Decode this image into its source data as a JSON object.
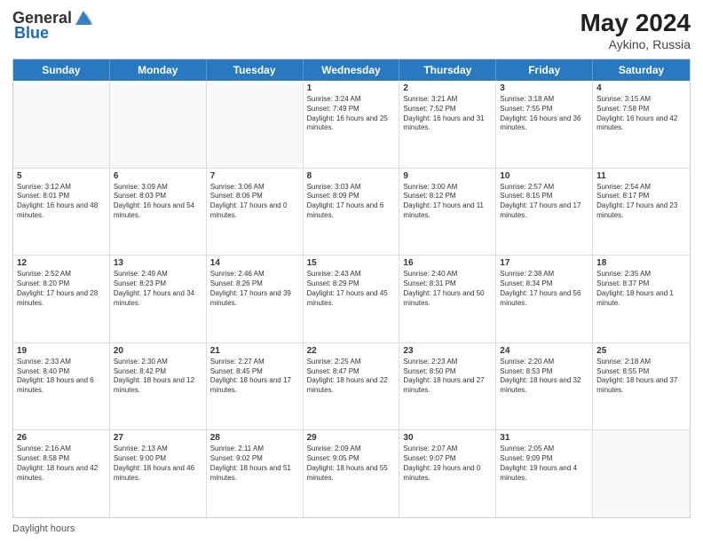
{
  "header": {
    "logo_general": "General",
    "logo_blue": "Blue",
    "month_year": "May 2024",
    "location": "Aykino, Russia"
  },
  "footer": {
    "daylight_label": "Daylight hours"
  },
  "days_of_week": [
    "Sunday",
    "Monday",
    "Tuesday",
    "Wednesday",
    "Thursday",
    "Friday",
    "Saturday"
  ],
  "weeks": [
    [
      {
        "day": "",
        "empty": true
      },
      {
        "day": "",
        "empty": true
      },
      {
        "day": "",
        "empty": true
      },
      {
        "day": "1",
        "sunrise": "Sunrise: 3:24 AM",
        "sunset": "Sunset: 7:49 PM",
        "daylight": "Daylight: 16 hours and 25 minutes."
      },
      {
        "day": "2",
        "sunrise": "Sunrise: 3:21 AM",
        "sunset": "Sunset: 7:52 PM",
        "daylight": "Daylight: 16 hours and 31 minutes."
      },
      {
        "day": "3",
        "sunrise": "Sunrise: 3:18 AM",
        "sunset": "Sunset: 7:55 PM",
        "daylight": "Daylight: 16 hours and 36 minutes."
      },
      {
        "day": "4",
        "sunrise": "Sunrise: 3:15 AM",
        "sunset": "Sunset: 7:58 PM",
        "daylight": "Daylight: 16 hours and 42 minutes."
      }
    ],
    [
      {
        "day": "5",
        "sunrise": "Sunrise: 3:12 AM",
        "sunset": "Sunset: 8:01 PM",
        "daylight": "Daylight: 16 hours and 48 minutes."
      },
      {
        "day": "6",
        "sunrise": "Sunrise: 3:09 AM",
        "sunset": "Sunset: 8:03 PM",
        "daylight": "Daylight: 16 hours and 54 minutes."
      },
      {
        "day": "7",
        "sunrise": "Sunrise: 3:06 AM",
        "sunset": "Sunset: 8:06 PM",
        "daylight": "Daylight: 17 hours and 0 minutes."
      },
      {
        "day": "8",
        "sunrise": "Sunrise: 3:03 AM",
        "sunset": "Sunset: 8:09 PM",
        "daylight": "Daylight: 17 hours and 6 minutes."
      },
      {
        "day": "9",
        "sunrise": "Sunrise: 3:00 AM",
        "sunset": "Sunset: 8:12 PM",
        "daylight": "Daylight: 17 hours and 11 minutes."
      },
      {
        "day": "10",
        "sunrise": "Sunrise: 2:57 AM",
        "sunset": "Sunset: 8:15 PM",
        "daylight": "Daylight: 17 hours and 17 minutes."
      },
      {
        "day": "11",
        "sunrise": "Sunrise: 2:54 AM",
        "sunset": "Sunset: 8:17 PM",
        "daylight": "Daylight: 17 hours and 23 minutes."
      }
    ],
    [
      {
        "day": "12",
        "sunrise": "Sunrise: 2:52 AM",
        "sunset": "Sunset: 8:20 PM",
        "daylight": "Daylight: 17 hours and 28 minutes."
      },
      {
        "day": "13",
        "sunrise": "Sunrise: 2:49 AM",
        "sunset": "Sunset: 8:23 PM",
        "daylight": "Daylight: 17 hours and 34 minutes."
      },
      {
        "day": "14",
        "sunrise": "Sunrise: 2:46 AM",
        "sunset": "Sunset: 8:26 PM",
        "daylight": "Daylight: 17 hours and 39 minutes."
      },
      {
        "day": "15",
        "sunrise": "Sunrise: 2:43 AM",
        "sunset": "Sunset: 8:29 PM",
        "daylight": "Daylight: 17 hours and 45 minutes."
      },
      {
        "day": "16",
        "sunrise": "Sunrise: 2:40 AM",
        "sunset": "Sunset: 8:31 PM",
        "daylight": "Daylight: 17 hours and 50 minutes."
      },
      {
        "day": "17",
        "sunrise": "Sunrise: 2:38 AM",
        "sunset": "Sunset: 8:34 PM",
        "daylight": "Daylight: 17 hours and 56 minutes."
      },
      {
        "day": "18",
        "sunrise": "Sunrise: 2:35 AM",
        "sunset": "Sunset: 8:37 PM",
        "daylight": "Daylight: 18 hours and 1 minute."
      }
    ],
    [
      {
        "day": "19",
        "sunrise": "Sunrise: 2:33 AM",
        "sunset": "Sunset: 8:40 PM",
        "daylight": "Daylight: 18 hours and 6 minutes."
      },
      {
        "day": "20",
        "sunrise": "Sunrise: 2:30 AM",
        "sunset": "Sunset: 8:42 PM",
        "daylight": "Daylight: 18 hours and 12 minutes."
      },
      {
        "day": "21",
        "sunrise": "Sunrise: 2:27 AM",
        "sunset": "Sunset: 8:45 PM",
        "daylight": "Daylight: 18 hours and 17 minutes."
      },
      {
        "day": "22",
        "sunrise": "Sunrise: 2:25 AM",
        "sunset": "Sunset: 8:47 PM",
        "daylight": "Daylight: 18 hours and 22 minutes."
      },
      {
        "day": "23",
        "sunrise": "Sunrise: 2:23 AM",
        "sunset": "Sunset: 8:50 PM",
        "daylight": "Daylight: 18 hours and 27 minutes."
      },
      {
        "day": "24",
        "sunrise": "Sunrise: 2:20 AM",
        "sunset": "Sunset: 8:53 PM",
        "daylight": "Daylight: 18 hours and 32 minutes."
      },
      {
        "day": "25",
        "sunrise": "Sunrise: 2:18 AM",
        "sunset": "Sunset: 8:55 PM",
        "daylight": "Daylight: 18 hours and 37 minutes."
      }
    ],
    [
      {
        "day": "26",
        "sunrise": "Sunrise: 2:16 AM",
        "sunset": "Sunset: 8:58 PM",
        "daylight": "Daylight: 18 hours and 42 minutes."
      },
      {
        "day": "27",
        "sunrise": "Sunrise: 2:13 AM",
        "sunset": "Sunset: 9:00 PM",
        "daylight": "Daylight: 18 hours and 46 minutes."
      },
      {
        "day": "28",
        "sunrise": "Sunrise: 2:11 AM",
        "sunset": "Sunset: 9:02 PM",
        "daylight": "Daylight: 18 hours and 51 minutes."
      },
      {
        "day": "29",
        "sunrise": "Sunrise: 2:09 AM",
        "sunset": "Sunset: 9:05 PM",
        "daylight": "Daylight: 18 hours and 55 minutes."
      },
      {
        "day": "30",
        "sunrise": "Sunrise: 2:07 AM",
        "sunset": "Sunset: 9:07 PM",
        "daylight": "Daylight: 19 hours and 0 minutes."
      },
      {
        "day": "31",
        "sunrise": "Sunrise: 2:05 AM",
        "sunset": "Sunset: 9:09 PM",
        "daylight": "Daylight: 19 hours and 4 minutes."
      },
      {
        "day": "",
        "empty": true
      }
    ]
  ]
}
